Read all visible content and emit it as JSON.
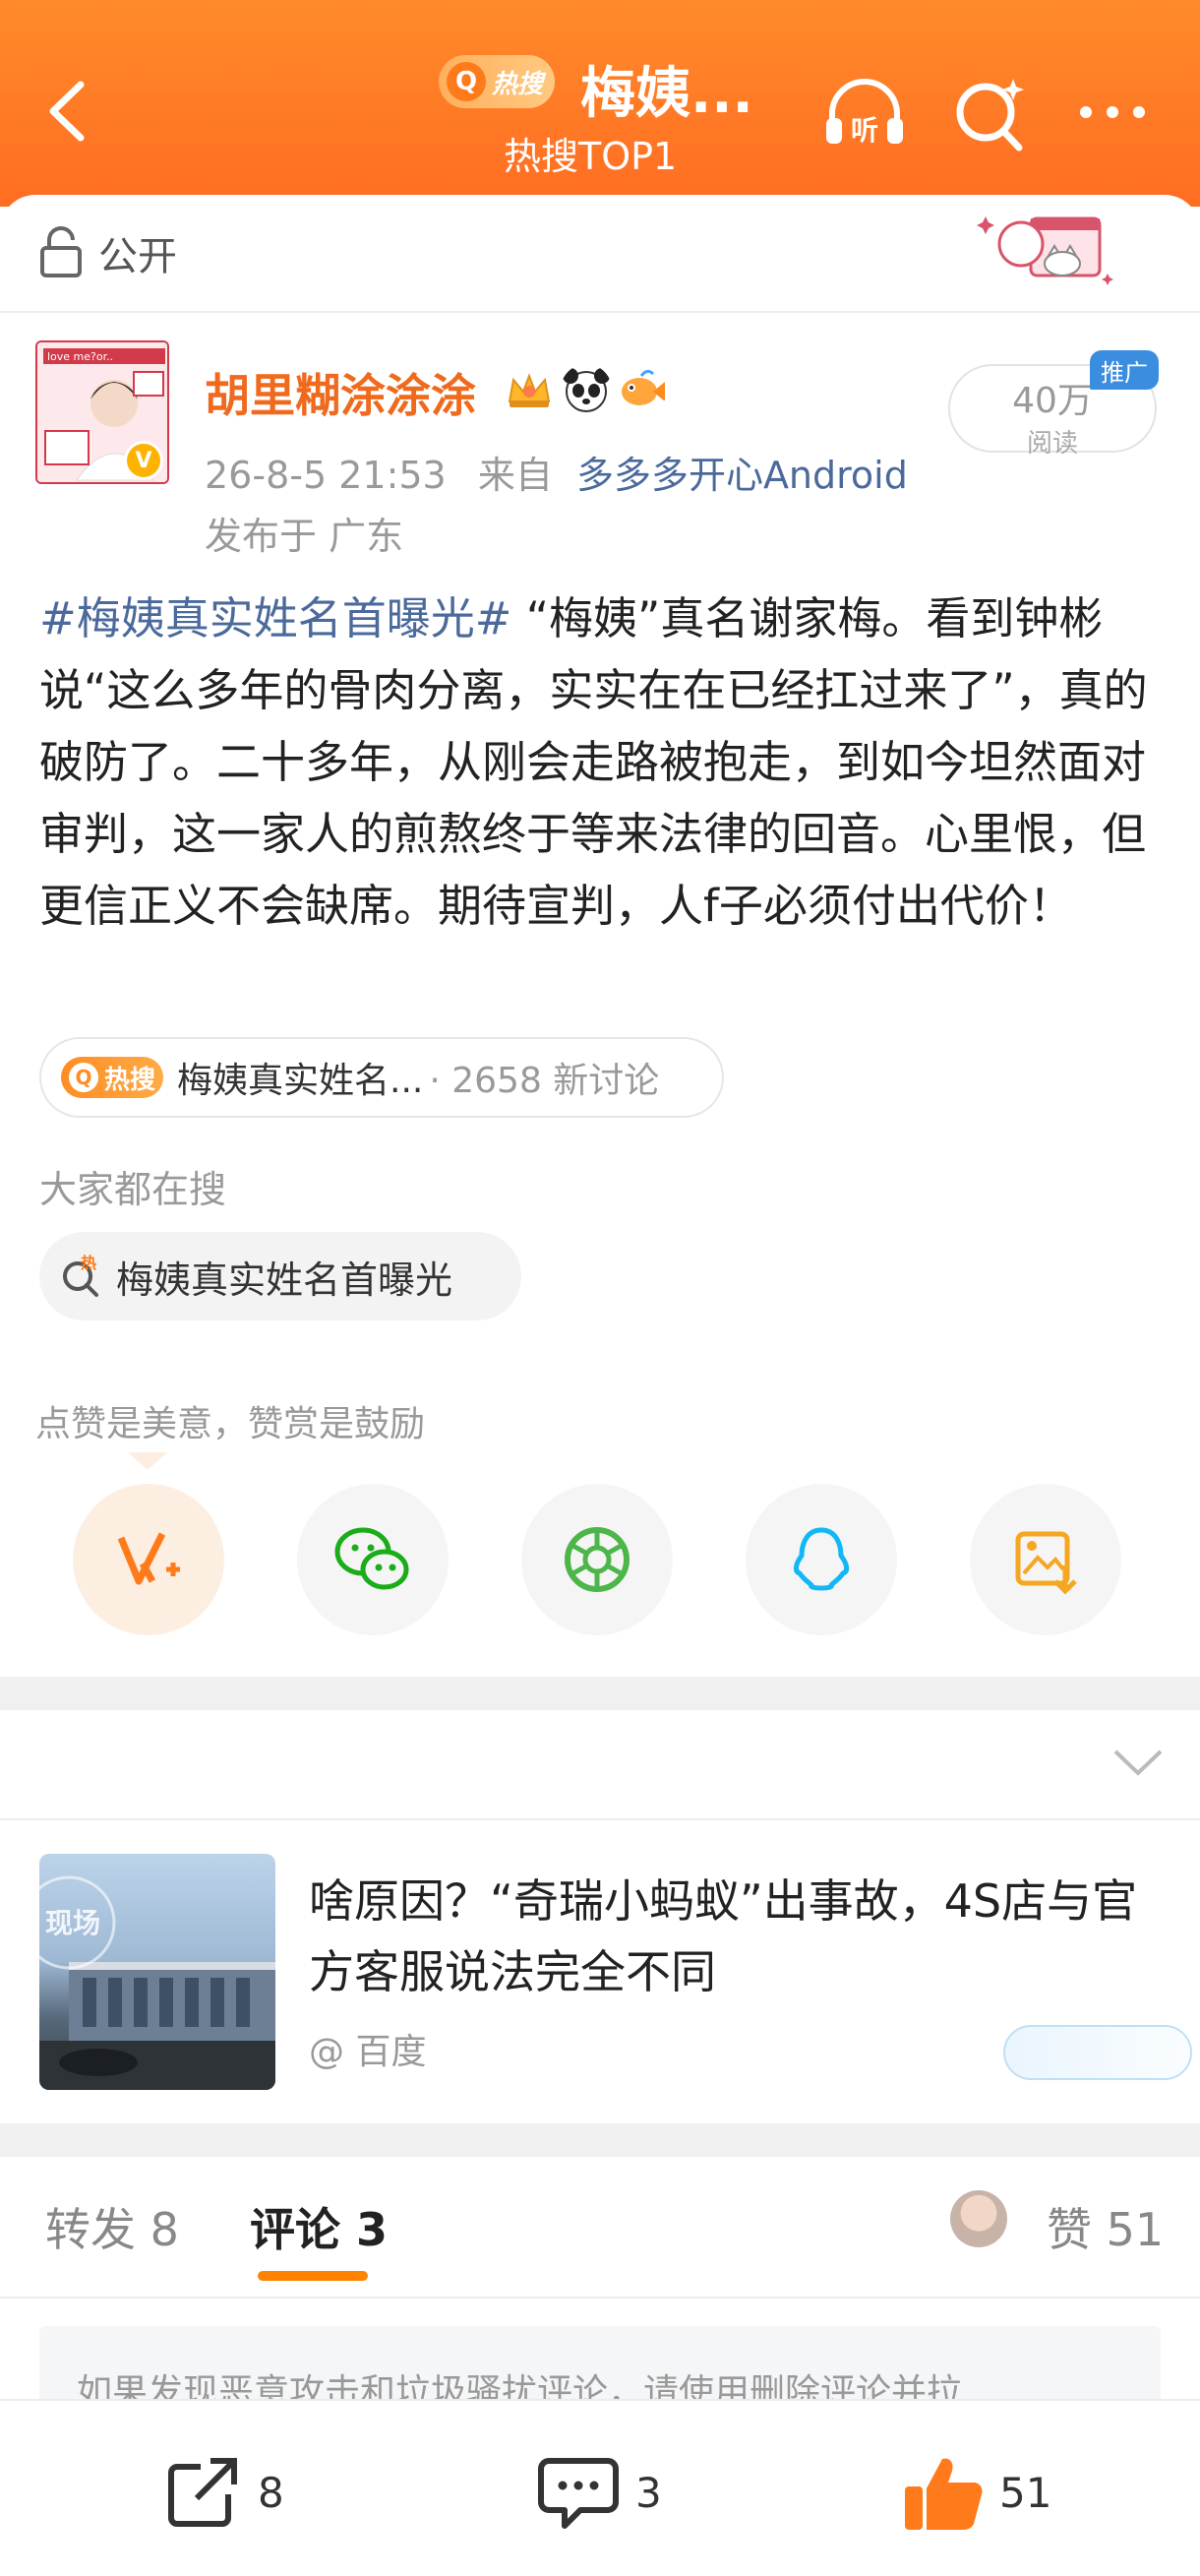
{
  "header": {
    "hot_badge": "热搜",
    "title": "梅姨...",
    "subtitle": "热搜TOP1",
    "listen_label": "听"
  },
  "visibility": {
    "label": "公开"
  },
  "post": {
    "username": "胡里糊涂涂涂",
    "avatar_text": "love me?or..",
    "verified_mark": "V",
    "time": "26-8-5 21:53",
    "from_prefix": "来自",
    "source": "多多多开心Android",
    "location": "发布于 广东",
    "reads_count": "40万",
    "reads_label": "阅读",
    "promo_tag": "推广",
    "hashtag": "#梅姨真实姓名首曝光#",
    "body": " “梅姨”真名谢家梅。看到钟彬说“这么多年的骨肉分离，实实在在已经扛过来了”，真的破防了。二十多年，从刚会走路被抱走，到如今坦然面对审判，这一家人的煎熬终于等来法律的回音。心里恨，但更信正义不会缺席。期待宣判，人f子必须付出代价！"
  },
  "hot_topic": {
    "badge": "热搜",
    "text": "梅姨真实姓名...",
    "count": "· 2658 新讨论"
  },
  "search": {
    "heading": "大家都在搜",
    "chip_badge": "热",
    "chip_text": "梅姨真实姓名首曝光"
  },
  "share": {
    "tip": "点赞是美意，赞赏是鼓励",
    "targets": [
      "weibo-reward",
      "wechat",
      "moments",
      "qq",
      "save-image"
    ]
  },
  "news": {
    "title": "啥原因？“奇瑞小蚂蚁”出事故，4S店与官方客服说法完全不同",
    "source": "@ 百度",
    "thumb_label": "现场"
  },
  "tabs": {
    "repost": "转发 8",
    "comments": "评论 3",
    "likes": "赞 51"
  },
  "notice": "如果发现恶意攻击和垃圾骚扰评论，请使用删除评论并拉",
  "bottom_bar": {
    "repost_count": "8",
    "comment_count": "3",
    "like_count": "51"
  },
  "colors": {
    "header_orange": "#ff7a26",
    "link_blue": "#4b6a9b",
    "username_orange": "#f06a1d",
    "like_orange": "#ff7a1a"
  }
}
